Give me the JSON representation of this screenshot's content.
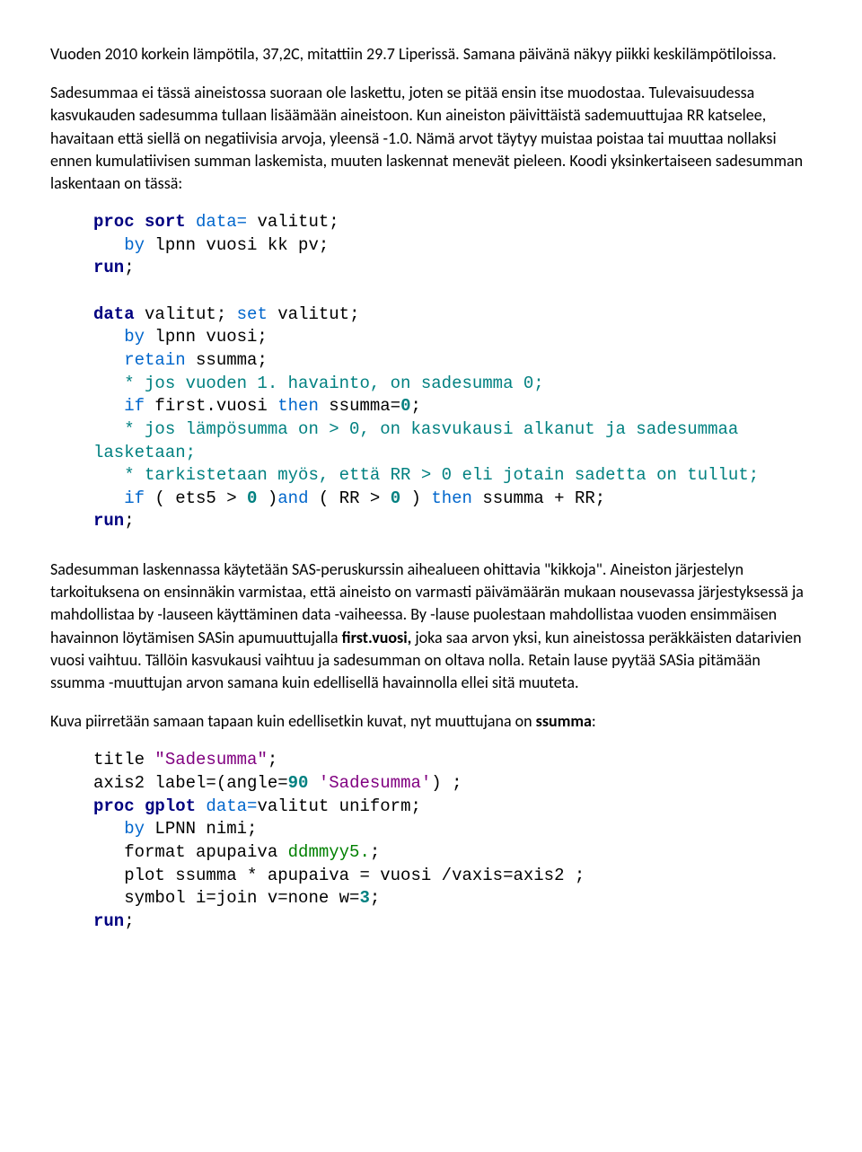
{
  "p1": "Vuoden 2010 korkein lämpötila, 37,2C, mitattiin 29.7 Liperissä. Samana päivänä näkyy piikki keskilämpötiloissa.",
  "p2": "Sadesummaa ei tässä aineistossa suoraan ole laskettu, joten se pitää ensin itse muodostaa. Tulevaisuudessa kasvukauden sadesumma tullaan lisäämään aineistoon. Kun aineiston päivittäistä sademuuttujaa RR katselee, havaitaan että siellä on negatiivisia arvoja, yleensä -1.0. Nämä arvot täytyy muistaa poistaa tai muuttaa nollaksi ennen kumulatiivisen summan laskemista, muuten laskennat menevät pieleen. Koodi yksinkertaiseen sadesumman laskentaan on tässä:",
  "code1": {
    "l1_proc": "proc",
    "l1_sort": "sort",
    "l1_dataeq": "data=",
    "l1_valitut": " valitut;",
    "l2_by": "   by",
    "l2_rest": " lpnn vuosi kk pv;",
    "l3_run": "run",
    "l5_data": "data",
    "l5_valitut1": " valitut; ",
    "l5_set": "set",
    "l5_valitut2": " valitut;",
    "l6_by": "   by",
    "l6_rest": " lpnn vuosi;",
    "l7_retain": "   retain",
    "l7_rest": " ssumma;",
    "l8_comment": "   * jos vuoden 1. havainto, on sadesumma 0;",
    "l9_if": "   if",
    "l9_first": " first.vuosi ",
    "l9_then": "then",
    "l9_ssumma": " ssumma=",
    "l9_zero": "0",
    "l9_semi": ";",
    "l10a": "   * jos lämpösumma on > 0, on kasvukausi alkanut ja sadesummaa",
    "l10b": "lasketaan;",
    "l11": "   * tarkistetaan myös, että RR > 0 eli jotain sadetta on tullut;",
    "l12_if": "   if",
    "l12_a": " ( ets5 > ",
    "l12_z1": "0",
    "l12_b": " )",
    "l12_and": "and",
    "l12_c": " ( RR > ",
    "l12_z2": "0",
    "l12_d": " ) ",
    "l12_then": "then",
    "l12_e": " ssumma + RR;",
    "l13_run": "run"
  },
  "p3a": "Sadesumman laskennassa käytetään SAS-peruskurssin aihealueen ohittavia \"kikkoja\". Aineiston järjestelyn tarkoituksena on ensinnäkin varmistaa, että aineisto on varmasti päivämäärän mukaan nousevassa järjestyksessä ja mahdollistaa by -lauseen käyttäminen data -vaiheessa. By -lause puolestaan mahdollistaa vuoden ensimmäisen havainnon löytämisen SASin apumuuttujalla ",
  "p3b": "first.vuosi,",
  "p3c": " joka saa arvon yksi, kun aineistossa peräkkäisten datarivien vuosi vaihtuu. Tällöin kasvukausi vaihtuu ja sadesumman on oltava nolla. Retain lause pyytää SASia pitämään ssumma -muuttujan arvon samana kuin edellisellä havainnolla ellei sitä muuteta.",
  "p4a": "Kuva piirretään samaan tapaan kuin edellisetkin kuvat, nyt muuttujana on ",
  "p4b": "ssumma",
  "p4c": ":",
  "code2": {
    "l1_title": "title ",
    "l1_str": "\"Sadesumma\"",
    "l1_semi": ";",
    "l2_a": "axis2 label=(angle=",
    "l2_90": "90",
    "l2_sp": " ",
    "l2_str": "'Sadesumma'",
    "l2_b": ") ;",
    "l3_proc": "proc",
    "l3_gplot": " gplot",
    "l3_dataeq": " data=",
    "l3_rest": "valitut uniform;",
    "l4_by": "   by",
    "l4_rest": " LPNN nimi;",
    "l5_a": "   format apupaiva ",
    "l5_fmt": "ddmmyy5.",
    "l5_semi": ";",
    "l6": "   plot ssumma * apupaiva = vuosi /vaxis=axis2 ;",
    "l7_a": "   symbol i=join v=none w=",
    "l7_3": "3",
    "l7_semi": ";",
    "l8_run": "run"
  }
}
